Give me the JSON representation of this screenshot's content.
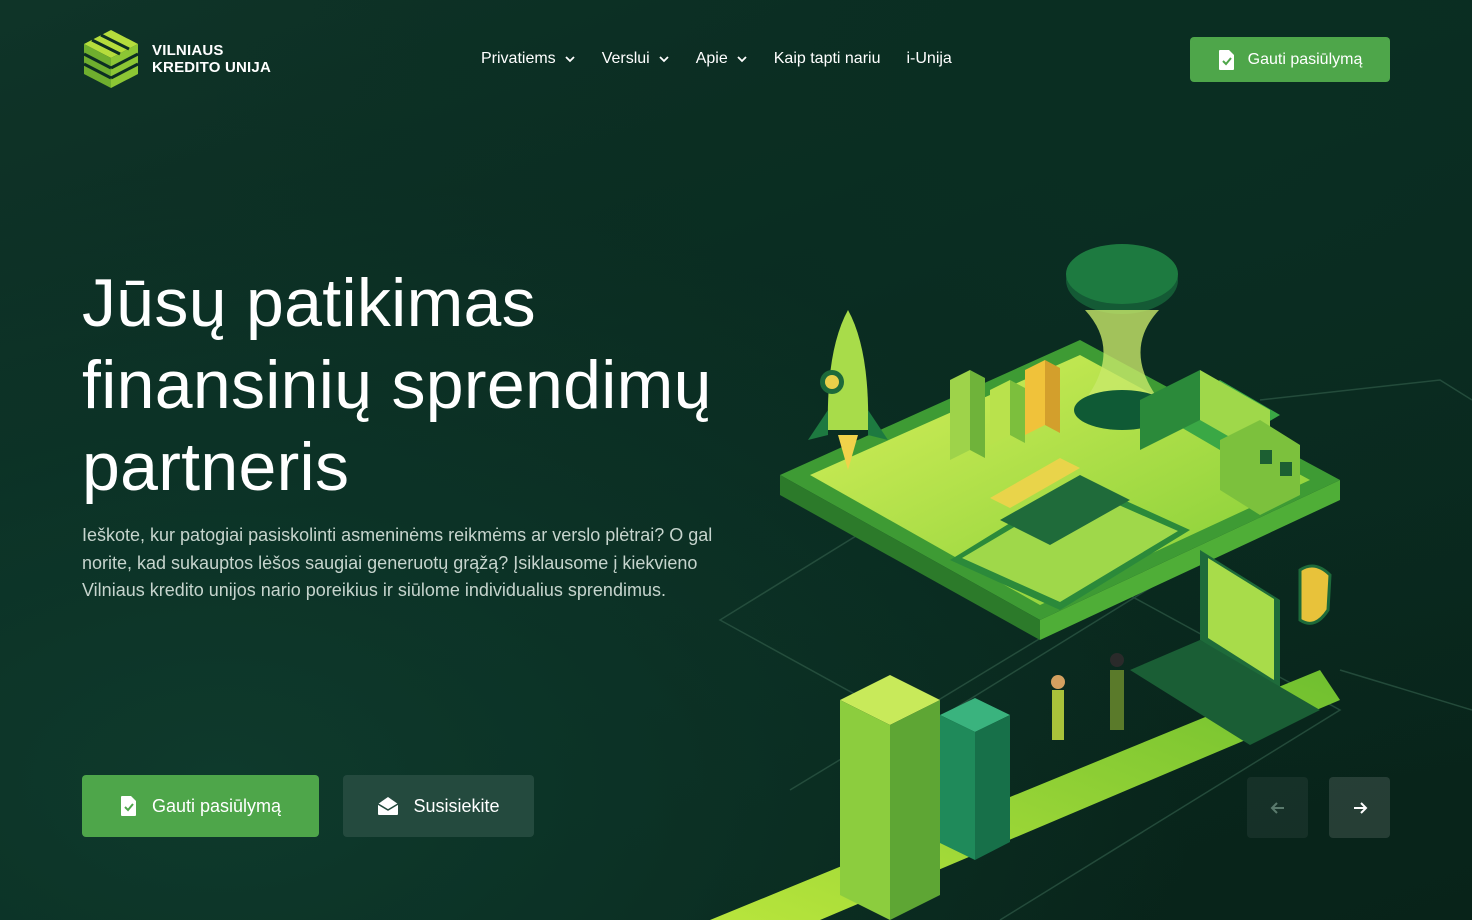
{
  "logo": {
    "line1": "VILNIAUS",
    "line2": "KREDITO UNIJA"
  },
  "nav": {
    "items": [
      {
        "label": "Privatiems",
        "has_dropdown": true
      },
      {
        "label": "Verslui",
        "has_dropdown": true
      },
      {
        "label": "Apie",
        "has_dropdown": true
      },
      {
        "label": "Kaip tapti nariu",
        "has_dropdown": false
      },
      {
        "label": "i-Unija",
        "has_dropdown": false
      }
    ]
  },
  "header": {
    "cta_label": "Gauti pasiūlymą",
    "cta_icon": "document-check-icon"
  },
  "hero": {
    "title_line1": "Jūsų patikimas",
    "title_line2": "finansinių sprendimų",
    "title_line3": "partneris",
    "subtitle": "Ieškote, kur patogiai pasiskolinti asmeninėms reikmėms ar verslo plėtrai? O gal norite, kad sukauptos lėšos saugiai generuotų grąžą? Įsiklausome į kiekvieno Vilniaus kredito unijos nario poreikius ir siūlome individualius sprendimus.",
    "primary_button": "Gauti pasiūlymą",
    "secondary_button": "Susisiekite"
  },
  "colors": {
    "background": "#0a2a20",
    "accent_green": "#4ea64a",
    "secondary_button": "#244a3e",
    "lime": "#a8e03a"
  },
  "icons": {
    "prev": "arrow-left-icon",
    "next": "arrow-right-icon",
    "contact": "envelope-open-icon"
  }
}
